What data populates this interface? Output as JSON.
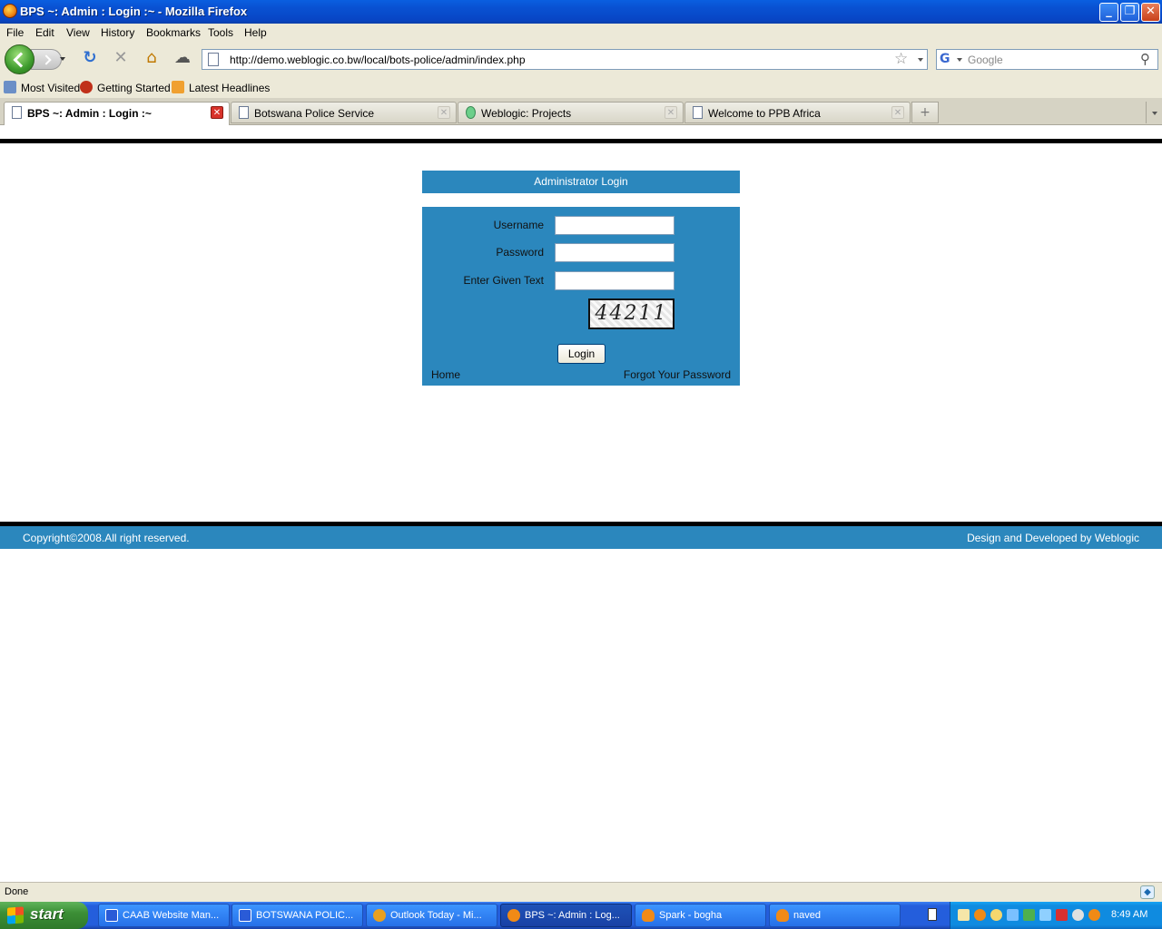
{
  "window": {
    "title": "BPS ~: Admin : Login :~ - Mozilla Firefox",
    "controls": {
      "minimize": "_",
      "maximize": "❐",
      "close": "✕"
    }
  },
  "menu": [
    "File",
    "Edit",
    "View",
    "History",
    "Bookmarks",
    "Tools",
    "Help"
  ],
  "navigation": {
    "url": "http://demo.weblogic.co.bw/local/bots-police/admin/index.php",
    "search_placeholder": "Google"
  },
  "bookmarks": [
    "Most Visited",
    "Getting Started",
    "Latest Headlines"
  ],
  "tabs": [
    {
      "label": "BPS ~: Admin : Login :~",
      "active": true
    },
    {
      "label": "Botswana Police Service",
      "active": false
    },
    {
      "label": "Weblogic: Projects",
      "active": false
    },
    {
      "label": "Welcome to PPB Africa",
      "active": false
    }
  ],
  "page": {
    "login_title": "Administrator Login",
    "fields": {
      "username_label": "Username",
      "password_label": "Password",
      "captcha_label": "Enter Given Text"
    },
    "captcha_text": "44211",
    "login_button": "Login",
    "home_link": "Home",
    "forgot_link": "Forgot Your Password",
    "footer": {
      "copyright": "Copyright©2008.All right reserved.",
      "developer": "Design and Developed by Weblogic"
    },
    "colors": {
      "panel": "#2b87bd",
      "rule": "#000000"
    }
  },
  "status": {
    "text": "Done"
  },
  "taskbar": {
    "start_label": "start",
    "tasks": [
      {
        "label": "CAAB Website Man...",
        "icon_color": "#2a5bd7",
        "active": false
      },
      {
        "label": "BOTSWANA POLIC...",
        "icon_color": "#2a5bd7",
        "active": false
      },
      {
        "label": "Outlook Today - Mi...",
        "icon_color": "#e8a020",
        "active": false
      },
      {
        "label": "BPS ~: Admin : Log...",
        "icon_color": "#f08a16",
        "active": true
      },
      {
        "label": "Spark - bogha",
        "icon_color": "#f08a16",
        "active": false
      },
      {
        "label": "naved",
        "icon_color": "#f08a16",
        "active": false
      }
    ],
    "clock": "8:49 AM"
  }
}
